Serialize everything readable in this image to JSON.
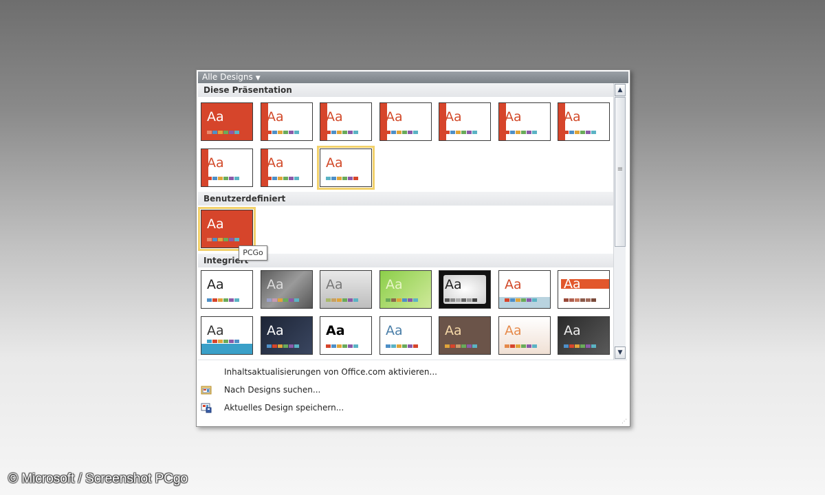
{
  "panel": {
    "title": "Alle Designs",
    "sections": {
      "this_presentation": "Diese Präsentation",
      "custom": "Benutzerdefiniert",
      "builtin": "Integriert"
    },
    "tooltip": "PCGo"
  },
  "menu": {
    "items": [
      {
        "label": "Inhaltsaktualisierungen von Office.com aktivieren...",
        "icon": "none"
      },
      {
        "label": "Nach Designs suchen...",
        "icon": "folder-browse-icon"
      },
      {
        "label": "Aktuelles Design speichern...",
        "icon": "save-design-icon"
      }
    ]
  },
  "thumb_label": "Aa",
  "swatch_colors": [
    "#d6452b",
    "#4e8fc7",
    "#e0a43a",
    "#6aaa5a",
    "#8b5aa8",
    "#5bb3c4"
  ],
  "copyright": "© Microsoft / Screenshot PCgo"
}
